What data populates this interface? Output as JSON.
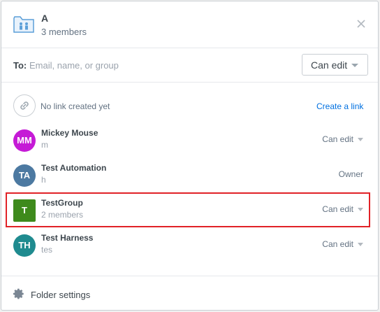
{
  "header": {
    "title": "A",
    "subtitle": "3 members",
    "icon": "shared-folder-icon",
    "close_icon": "close-icon"
  },
  "share": {
    "to_label": "To:",
    "to_placeholder": "Email, name, or group",
    "permission_label": "Can edit"
  },
  "link": {
    "icon": "link-icon",
    "status": "No link created yet",
    "action": "Create a link"
  },
  "members": [
    {
      "initials": "MM",
      "name": "Mickey Mouse",
      "sub": "m",
      "role": "Can edit",
      "color": "#c51bd6",
      "shape": "circle",
      "editable": true
    },
    {
      "initials": "TA",
      "name": "Test Automation",
      "sub": "h",
      "role": "Owner",
      "color": "#4c79a1",
      "shape": "circle",
      "editable": false
    },
    {
      "initials": "T",
      "name": "TestGroup",
      "sub": "2 members",
      "role": "Can edit",
      "color": "#3e8a1c",
      "shape": "square",
      "editable": true
    },
    {
      "initials": "TH",
      "name": "Test Harness",
      "sub": "tes",
      "role": "Can edit",
      "color": "#1f8b8f",
      "shape": "circle",
      "editable": true
    }
  ],
  "footer": {
    "icon": "gear-icon",
    "label": "Folder settings"
  },
  "colors": {
    "accent": "#0070e0",
    "highlight": "#e12227"
  }
}
